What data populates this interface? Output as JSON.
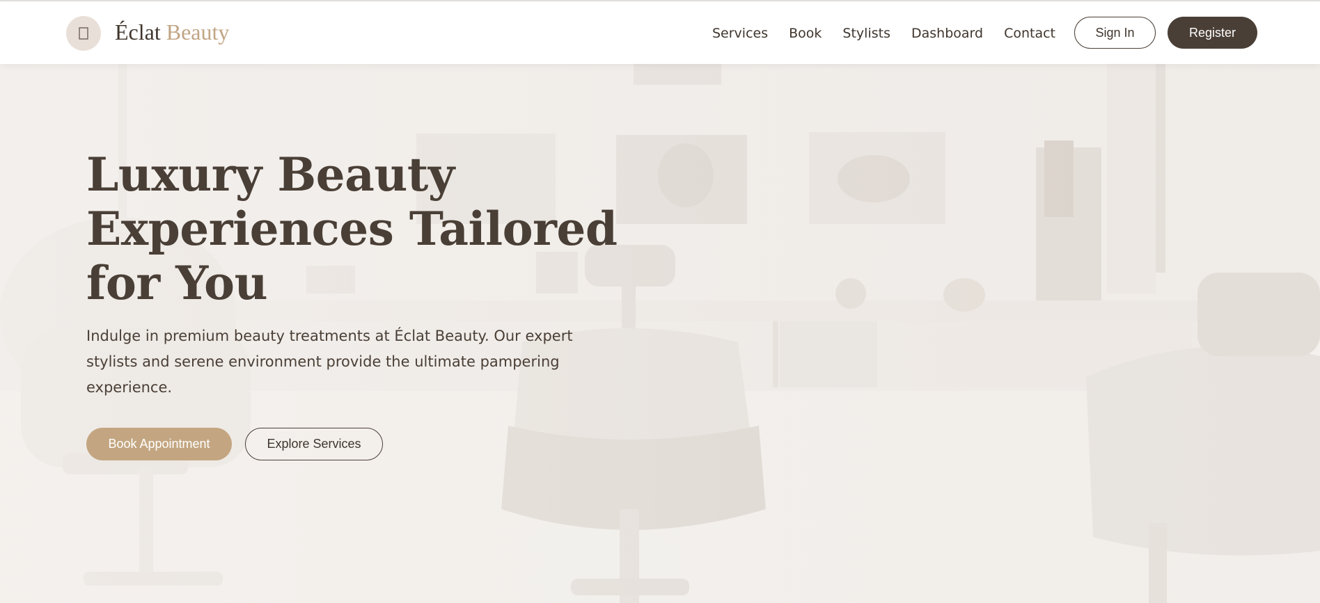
{
  "brand": {
    "name_part1": "Éclat",
    "name_part2": "Beauty",
    "logo_icon": "spa-icon"
  },
  "nav": {
    "items": [
      "Services",
      "Book",
      "Stylists",
      "Dashboard",
      "Contact"
    ]
  },
  "auth": {
    "sign_in_label": "Sign In",
    "register_label": "Register"
  },
  "hero": {
    "title": "Luxury Beauty Experiences Tailored for You",
    "subtitle": "Indulge in premium beauty treatments at Éclat Beauty. Our expert stylists and serene environment provide the ultimate pampering experience.",
    "primary_cta": "Book Appointment",
    "secondary_cta": "Explore Services",
    "background_image": "salon-interior"
  },
  "colors": {
    "primary_dark": "#4a3f36",
    "accent_gold": "#c3a681",
    "brand_accent_text": "#c1a584",
    "logo_badge_bg": "#e9dfd9",
    "hero_bg": "#f3efeb"
  }
}
